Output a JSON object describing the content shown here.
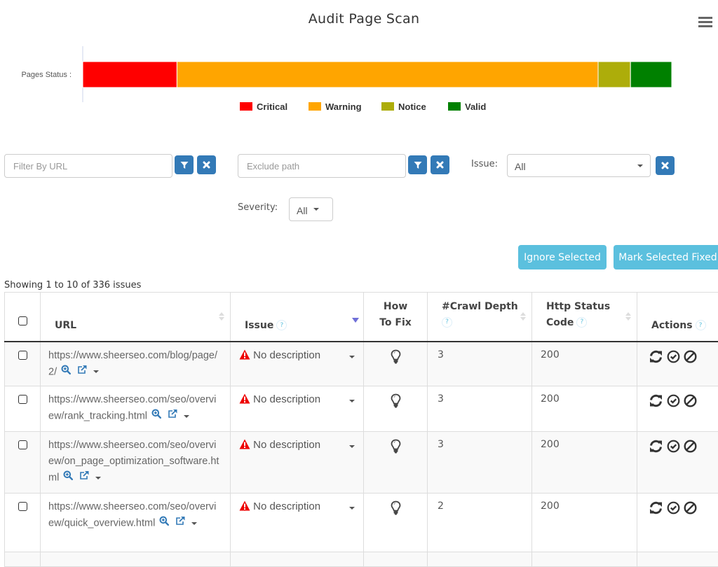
{
  "header": {
    "title": "Audit Page Scan",
    "menu_icon": "hamburger-menu-icon"
  },
  "chart_data": {
    "type": "bar",
    "orientation": "horizontal-stacked",
    "title": "",
    "ylabel": "Pages Status :",
    "categories": [
      "Pages Status"
    ],
    "unit": "percent of pages (estimated from bar widths)",
    "series": [
      {
        "name": "Critical",
        "values": [
          16
        ],
        "color": "#ff0000"
      },
      {
        "name": "Warning",
        "values": [
          71.5
        ],
        "color": "#ffa500"
      },
      {
        "name": "Notice",
        "values": [
          5.5
        ],
        "color": "#adad0a"
      },
      {
        "name": "Valid",
        "values": [
          7
        ],
        "color": "#008000"
      }
    ],
    "xlim": [
      0,
      100
    ],
    "grid": false,
    "legend_position": "bottom-center"
  },
  "filters": {
    "url_filter": {
      "placeholder": "Filter By URL",
      "value": ""
    },
    "exclude_path": {
      "placeholder": "Exclude path",
      "value": ""
    },
    "issue_label": "Issue:",
    "issue_value": "All",
    "severity_label": "Severity:",
    "severity_value": "All"
  },
  "bulk_actions": {
    "ignore_selected": "Ignore Selected",
    "mark_selected_fixed": "Mark Selected Fixed"
  },
  "table": {
    "summary": "Showing 1 to 10 of 336 issues",
    "columns": {
      "url": "URL",
      "issue": "Issue",
      "how_to_fix_1": "How",
      "how_to_fix_2": "To Fix",
      "crawl_depth": "#Crawl Depth",
      "http_status_1": "Http Status",
      "http_status_2": "Code",
      "actions": "Actions",
      "help": "?"
    },
    "rows": [
      {
        "url": "https://www.sheerseo.com/blog/page/2/",
        "issue": "No description",
        "crawl_depth": "3",
        "http_status": "200"
      },
      {
        "url": "https://www.sheerseo.com/seo/overview/rank_tracking.html",
        "issue": "No description",
        "crawl_depth": "3",
        "http_status": "200"
      },
      {
        "url": "https://www.sheerseo.com/seo/overview/on_page_optimization_software.html",
        "issue": "No description",
        "crawl_depth": "3",
        "http_status": "200"
      },
      {
        "url": "https://www.sheerseo.com/seo/overview/quick_overview.html",
        "issue": "No description",
        "crawl_depth": "2",
        "http_status": "200"
      }
    ]
  }
}
